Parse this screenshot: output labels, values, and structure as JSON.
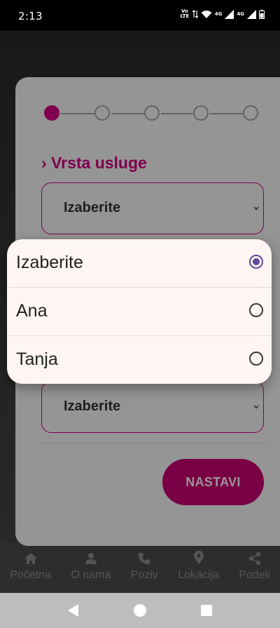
{
  "status_bar": {
    "time": "2:13",
    "volte": "Vo LTE",
    "net1": "4G",
    "net2": "4G"
  },
  "stepper": {
    "steps": 5,
    "active_index": 0
  },
  "form": {
    "section_title": "› Vrsta usluge",
    "select1_value": "Izaberite",
    "select2_value": "Izaberite",
    "next_label": "NASTAVI"
  },
  "dialog": {
    "options": [
      {
        "label": "Izaberite",
        "selected": true
      },
      {
        "label": "Ana",
        "selected": false
      },
      {
        "label": "Tanja",
        "selected": false
      }
    ]
  },
  "bottom_nav": {
    "items": [
      {
        "label": "Početna",
        "icon": "home-icon"
      },
      {
        "label": "O nama",
        "icon": "person-icon"
      },
      {
        "label": "Poziv",
        "icon": "phone-icon"
      },
      {
        "label": "Lokacija",
        "icon": "location-pin-icon"
      },
      {
        "label": "Podeli",
        "icon": "share-icon"
      }
    ]
  },
  "colors": {
    "accent": "#b0006e",
    "radio_selected": "#5f4a9a",
    "dialog_bg": "#fff6f3",
    "card_bg": "#cfcfcf"
  }
}
